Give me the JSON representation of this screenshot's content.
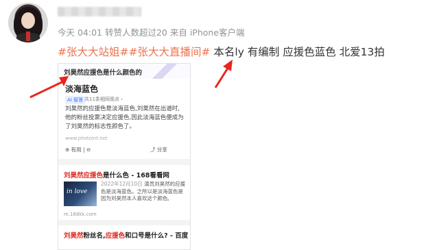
{
  "user": {
    "avatar": "avatar-photo",
    "name": ""
  },
  "post": {
    "meta": "今天 04:01 转赞人数超过20 来自 iPhone客户端",
    "hashtag1": "#张大大站姐#",
    "hashtag2": "#张大大直播间#",
    "text": " 本名ly 有编制 应援色蓝色 北爱13拍"
  },
  "card": {
    "header_title": "刘昊然应援色是什么颜色的",
    "answer": {
      "title": "淡海蓝色",
      "ai_badge": "AI 智答",
      "ref_count": "共11条相同观点 ›",
      "body": "刘昊然的应援色是淡海蓝色,刘昊然在出道时,他的粉丝投票决定应援色,因此淡海蓝色便成为了刘昊然的标志性颜色了。",
      "source": "www.photoint.net",
      "useful": "⊕ 有用 | ⊖",
      "share": "⤴ 分享"
    },
    "result1": {
      "title_red1": "刘昊然",
      "title_red2": "应援色",
      "title_rest": "是什么色 - 168看看网",
      "date": "2022年12月10日",
      "snippet": "演员刘昊然的应援色是淡海蓝色。之所以是淡海蓝色是因为刘昊然本人喜欢这个颜色,",
      "thumb_text": "in love",
      "url": "m.168kk.com"
    },
    "result2": {
      "title_red1": "刘昊然",
      "mid": "粉丝名,",
      "title_red2": "应援色",
      "title_rest": "和口号是什么? - 百度"
    }
  },
  "colors": {
    "hashtag": "#eb7350",
    "highlight": "#e0281e",
    "arrow": "#e8261c"
  }
}
